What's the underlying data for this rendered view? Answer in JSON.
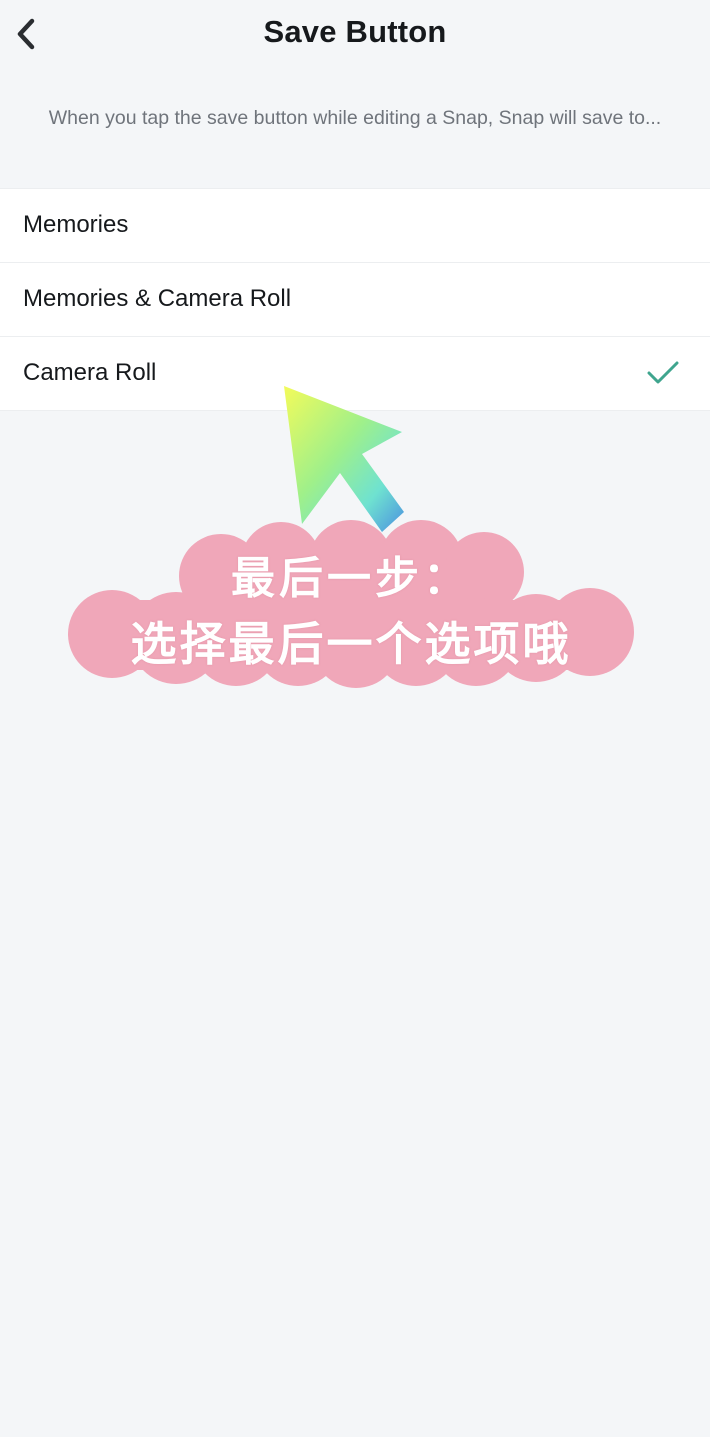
{
  "header": {
    "title": "Save Button",
    "back_icon": "chevron-left-icon"
  },
  "description": "When you tap the save button while editing a Snap, Snap will save to...",
  "options": [
    {
      "label": "Memories",
      "selected": false
    },
    {
      "label": "Memories & Camera Roll",
      "selected": false
    },
    {
      "label": "Camera Roll",
      "selected": true
    }
  ],
  "annotation": {
    "line1": "最后一步：",
    "line2": "选择最后一个选项哦",
    "arrow_icon": "gradient-arrow-icon",
    "cloud_color": "#f0a7b9"
  },
  "colors": {
    "background": "#f4f6f8",
    "check": "#3fa58e",
    "text": "#16191c",
    "muted": "#6f747b"
  }
}
